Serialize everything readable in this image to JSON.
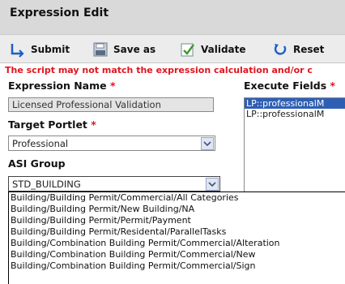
{
  "window": {
    "title": "Expression Edit"
  },
  "toolbar": {
    "submit_label": "Submit",
    "save_as_label": "Save as",
    "validate_label": "Validate",
    "reset_label": "Reset"
  },
  "warning": {
    "text": "The script may not match the expression calculation and/or c"
  },
  "form": {
    "expression_name": {
      "label": "Expression Name",
      "required_mark": "*",
      "value": "Licensed Professional Validation"
    },
    "target_portlet": {
      "label": "Target Portlet",
      "required_mark": "*",
      "value": "Professional"
    },
    "asi_group": {
      "label": "ASI Group",
      "value": "STD_BUILDING"
    },
    "execute_fields": {
      "label": "Execute Fields",
      "required_mark": "*",
      "items": [
        {
          "text": "LP::professionalM",
          "selected": true
        },
        {
          "text": "LP::professionalM",
          "selected": false
        }
      ]
    }
  },
  "asi_dropdown": {
    "options": [
      "Building/Building Permit/Commercial/All Categories",
      "Building/Building Permit/New Building/NA",
      "Building/Building Permit/Permit/Payment",
      "Building/Building Permit/Residental/ParallelTasks",
      "Building/Combination Building Permit/Commercial/Alteration",
      "Building/Combination Building Permit/Commercial/New",
      "Building/Combination Building Permit/Commercial/Sign"
    ]
  },
  "colors": {
    "warning": "#e0141e",
    "selection": "#2f5fb4",
    "title_bg": "#d9d9d9",
    "toolbar_bg": "#ececec"
  }
}
